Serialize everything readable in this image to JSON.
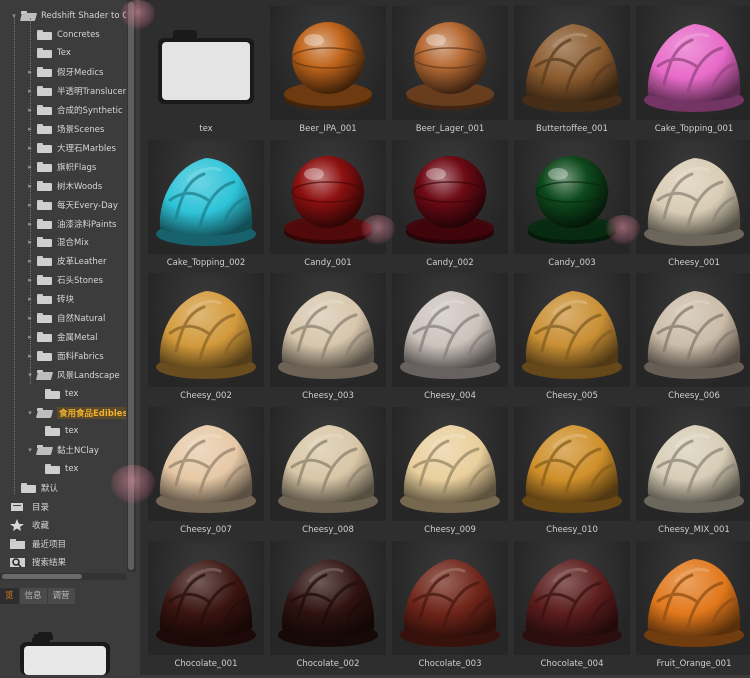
{
  "tree": {
    "root": "Redshift Shader to C",
    "items": [
      {
        "label": "Concretes",
        "depth": 2,
        "expander": false,
        "open": false
      },
      {
        "label": "Tex",
        "depth": 2,
        "expander": false,
        "open": false
      },
      {
        "label": "假牙Medics",
        "depth": 2,
        "expander": true,
        "open": false
      },
      {
        "label": "半透明Translucer",
        "depth": 2,
        "expander": true,
        "open": false
      },
      {
        "label": "合成的Synthetic",
        "depth": 2,
        "expander": true,
        "open": false
      },
      {
        "label": "场景Scenes",
        "depth": 2,
        "expander": true,
        "open": false
      },
      {
        "label": "大理石Marbles",
        "depth": 2,
        "expander": true,
        "open": false
      },
      {
        "label": "旗帜Flags",
        "depth": 2,
        "expander": true,
        "open": false
      },
      {
        "label": "树木Woods",
        "depth": 2,
        "expander": true,
        "open": false
      },
      {
        "label": "每天Every-Day",
        "depth": 2,
        "expander": true,
        "open": false
      },
      {
        "label": "油漆涂料Paints",
        "depth": 2,
        "expander": true,
        "open": false
      },
      {
        "label": "混合Mix",
        "depth": 2,
        "expander": true,
        "open": false
      },
      {
        "label": "皮革Leather",
        "depth": 2,
        "expander": true,
        "open": false
      },
      {
        "label": "石头Stones",
        "depth": 2,
        "expander": true,
        "open": false
      },
      {
        "label": "砖块",
        "depth": 2,
        "expander": true,
        "open": false
      },
      {
        "label": "自然Natural",
        "depth": 2,
        "expander": true,
        "open": false
      },
      {
        "label": "金属Metal",
        "depth": 2,
        "expander": true,
        "open": false
      },
      {
        "label": "面料Fabrics",
        "depth": 2,
        "expander": true,
        "open": false
      },
      {
        "label": "风景Landscape",
        "depth": 2,
        "expander": true,
        "open": true
      },
      {
        "label": "tex",
        "depth": 3,
        "expander": false,
        "open": false
      },
      {
        "label": "食用食品Edibles",
        "depth": 2,
        "expander": true,
        "open": true,
        "selected": true
      },
      {
        "label": "tex",
        "depth": 3,
        "expander": false,
        "open": false
      },
      {
        "label": "黏土NClay",
        "depth": 2,
        "expander": true,
        "open": true
      },
      {
        "label": "tex",
        "depth": 3,
        "expander": false,
        "open": false
      },
      {
        "label": "默认",
        "depth": 1,
        "expander": false,
        "open": false
      }
    ],
    "bottom": [
      {
        "label": "目录",
        "icon": "catalog-icon"
      },
      {
        "label": "收藏",
        "icon": "star-icon"
      },
      {
        "label": "最近项目",
        "icon": "folder-icon"
      },
      {
        "label": "搜索结果",
        "icon": "search-folder-icon"
      }
    ]
  },
  "tabs": [
    {
      "label": "览",
      "active": true
    },
    {
      "label": "信息",
      "active": false
    },
    {
      "label": "调营",
      "active": false
    }
  ],
  "grid": {
    "items": [
      {
        "label": "tex",
        "kind": "folder"
      },
      {
        "label": "Beer_IPA_001",
        "kind": "sphere",
        "color": "#c0651c",
        "glass": true
      },
      {
        "label": "Beer_Lager_001",
        "kind": "sphere",
        "color": "#b66a34",
        "glass": true
      },
      {
        "label": "Buttertoffee_001",
        "kind": "cloth",
        "color": "#8a5a2e"
      },
      {
        "label": "Cake_Topping_001",
        "kind": "cloth",
        "color": "#e76ac8"
      },
      {
        "label": "Cake_Topping_002",
        "kind": "cloth",
        "color": "#2ec3d8"
      },
      {
        "label": "Candy_001",
        "kind": "sphere",
        "color": "#8e1010",
        "glass": true
      },
      {
        "label": "Candy_002",
        "kind": "sphere",
        "color": "#6e0a14",
        "glass": true
      },
      {
        "label": "Candy_003",
        "kind": "sphere",
        "color": "#0e4a1c",
        "glass": true
      },
      {
        "label": "Cheesy_001",
        "kind": "cloth",
        "color": "#d8ccb4"
      },
      {
        "label": "Cheesy_002",
        "kind": "cloth",
        "color": "#d39a3c"
      },
      {
        "label": "Cheesy_003",
        "kind": "cloth",
        "color": "#d7c6ac"
      },
      {
        "label": "Cheesy_004",
        "kind": "cloth",
        "color": "#cdc3bd"
      },
      {
        "label": "Cheesy_005",
        "kind": "cloth",
        "color": "#c98f34"
      },
      {
        "label": "Cheesy_006",
        "kind": "cloth",
        "color": "#cbbca8"
      },
      {
        "label": "Cheesy_007",
        "kind": "cloth",
        "color": "#e6c9a6"
      },
      {
        "label": "Cheesy_008",
        "kind": "cloth",
        "color": "#d8c6a6"
      },
      {
        "label": "Cheesy_009",
        "kind": "cloth",
        "color": "#e9cf9c"
      },
      {
        "label": "Cheesy_010",
        "kind": "cloth",
        "color": "#cf8f2a"
      },
      {
        "label": "Cheesy_MIX_001",
        "kind": "cloth",
        "color": "#d7cdb7"
      },
      {
        "label": "Chocolate_001",
        "kind": "cloth",
        "color": "#3a1410"
      },
      {
        "label": "Chocolate_002",
        "kind": "cloth",
        "color": "#2e1210"
      },
      {
        "label": "Chocolate_003",
        "kind": "cloth",
        "color": "#6e2418"
      },
      {
        "label": "Chocolate_004",
        "kind": "cloth",
        "color": "#5a1c1c"
      },
      {
        "label": "Fruit_Orange_001",
        "kind": "cloth",
        "color": "#e1781c"
      }
    ]
  }
}
